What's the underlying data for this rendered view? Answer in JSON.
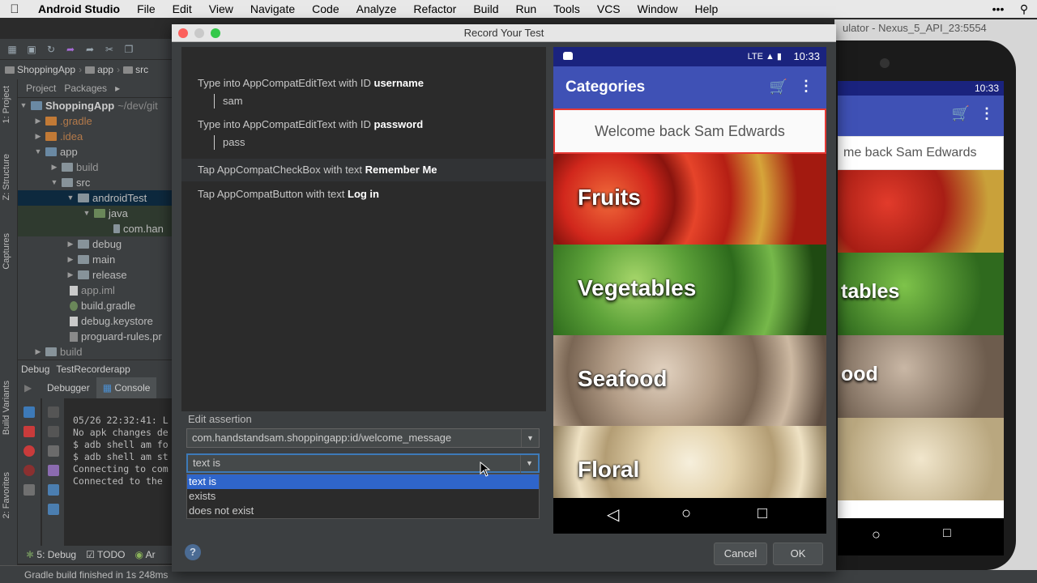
{
  "menubar": {
    "app": "Android Studio",
    "items": [
      "File",
      "Edit",
      "View",
      "Navigate",
      "Code",
      "Analyze",
      "Refactor",
      "Build",
      "Run",
      "Tools",
      "VCS",
      "Window",
      "Help"
    ]
  },
  "ide": {
    "breadcrumb": [
      "ShoppingApp",
      "app",
      "src"
    ],
    "project_tabs": [
      "Project",
      "Packages"
    ],
    "side_tabs": [
      "1: Project",
      "Z: Structure",
      "Captures",
      "Build Variants",
      "2: Favorites"
    ],
    "tree": {
      "root": "ShoppingApp",
      "root_path": "~/dev/git",
      "gradle": ".gradle",
      "idea": ".idea",
      "app": "app",
      "build": "build",
      "src": "src",
      "androidTest": "androidTest",
      "java": "java",
      "pkg": "com.han",
      "debug": "debug",
      "main": "main",
      "release": "release",
      "app_iml": "app.iml",
      "build_gradle": "build.gradle",
      "keystore": "debug.keystore",
      "proguard": "proguard-rules.pr",
      "build2": "build"
    },
    "debug_bar": {
      "label": "Debug",
      "config": "TestRecorderapp"
    },
    "debug_tabs": [
      "Debugger",
      "Console"
    ],
    "console_lines": [
      "05/26 22:32:41: L",
      "No apk changes de",
      "$ adb shell am fo",
      "$ adb shell am st",
      "Connecting to com",
      "Connected to the"
    ],
    "bottom_tabs": [
      "5: Debug",
      "TODO",
      "Ar"
    ],
    "status": "Gradle build finished in 1s 248ms"
  },
  "emulator": {
    "title": "ulator - Nexus_5_API_23:5554",
    "time": "10:33",
    "welcome": "me back Sam Edwards",
    "categories": [
      "",
      "tables",
      "ood",
      ""
    ]
  },
  "dialog": {
    "title": "Record Your Test",
    "events": [
      {
        "prefix": "Type into AppCompatEditText with ID ",
        "bold": "username",
        "value": "sam"
      },
      {
        "prefix": "Type into AppCompatEditText with ID ",
        "bold": "password",
        "value": "pass"
      },
      {
        "prefix": "Tap AppCompatCheckBox with text ",
        "bold": "Remember Me"
      },
      {
        "prefix": "Tap AppCompatButton with text ",
        "bold": "Log in"
      }
    ],
    "edit_assertion_label": "Edit assertion",
    "element_combo": "com.handstandsam.shoppingapp:id/welcome_message",
    "condition_combo": "text is",
    "condition_options": [
      "text is",
      "exists",
      "does not exist"
    ],
    "cancel": "Cancel",
    "ok": "OK",
    "help": "?"
  },
  "device": {
    "time": "10:33",
    "title": "Categories",
    "welcome": "Welcome back Sam Edwards",
    "categories": [
      "Fruits",
      "Vegetables",
      "Seafood",
      "Floral"
    ]
  },
  "colors": {
    "appbar": "#3f51b5",
    "statusbar": "#1a237e",
    "selection": "#2f65ca",
    "welcome_border": "#e53935"
  }
}
